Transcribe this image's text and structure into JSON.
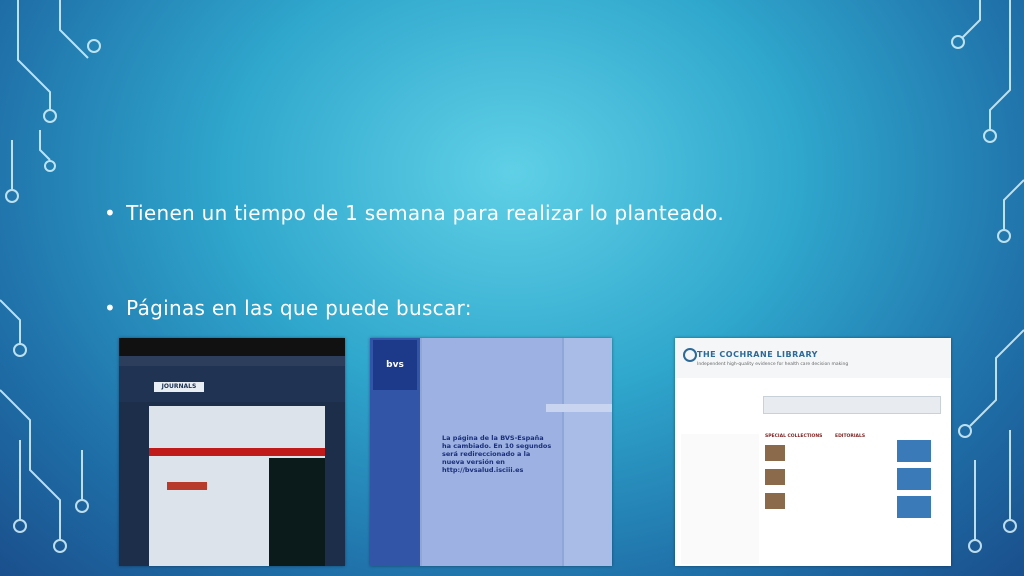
{
  "slide": {
    "bullets": [
      "Tienen un tiempo de 1 semana para realizar lo planteado.",
      "Páginas en las que puede buscar:"
    ],
    "bullet_symbol": "•"
  },
  "screenshots": {
    "cambridge": {
      "logo_text": "JOURNALS"
    },
    "bvs": {
      "logo_text": "bvs",
      "notice": "La página de la BVS-España ha cambiado. En 10 segundos será redireccionado a la nueva versión en http://bvsalud.isciii.es"
    },
    "cochrane": {
      "title": "THE COCHRANE LIBRARY",
      "subtitle": "Independent high-quality evidence for health care decision making",
      "sections": [
        "SPECIAL COLLECTIONS",
        "EDITORIALS"
      ]
    }
  },
  "colors": {
    "text": "#ffffff",
    "accent": "#2fa6cc"
  }
}
